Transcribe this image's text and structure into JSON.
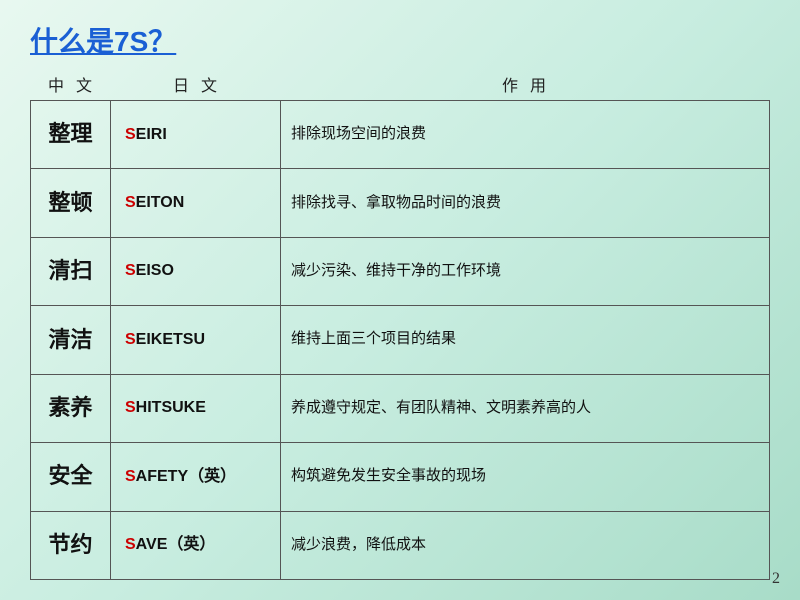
{
  "title": "什么是7S？",
  "header": {
    "chinese": "中 文",
    "japanese": "日 文",
    "effect": "作 用"
  },
  "rows": [
    {
      "chinese": "整理",
      "japanese_prefix": "S",
      "japanese_rest": "EIRI",
      "effect": "排除现场空间的浪费"
    },
    {
      "chinese": "整顿",
      "japanese_prefix": "S",
      "japanese_rest": "EITON",
      "effect": "排除找寻、拿取物品时间的浪费"
    },
    {
      "chinese": "清扫",
      "japanese_prefix": "S",
      "japanese_rest": "EISO",
      "effect": "减少污染、维持干净的工作环境"
    },
    {
      "chinese": "清洁",
      "japanese_prefix": "S",
      "japanese_rest": "EIKETSU",
      "effect": "维持上面三个项目的结果"
    },
    {
      "chinese": "素养",
      "japanese_prefix": "S",
      "japanese_rest": "HITSUKE",
      "effect": "养成遵守规定、有团队精神、文明素养高的人"
    },
    {
      "chinese": "安全",
      "japanese_prefix": "S",
      "japanese_rest": "AFETY（英）",
      "effect": "构筑避免发生安全事故的现场"
    },
    {
      "chinese": "节约",
      "japanese_prefix": "S",
      "japanese_rest": "AVE（英）",
      "effect": "减少浪费，降低成本"
    }
  ],
  "page_number": "2"
}
